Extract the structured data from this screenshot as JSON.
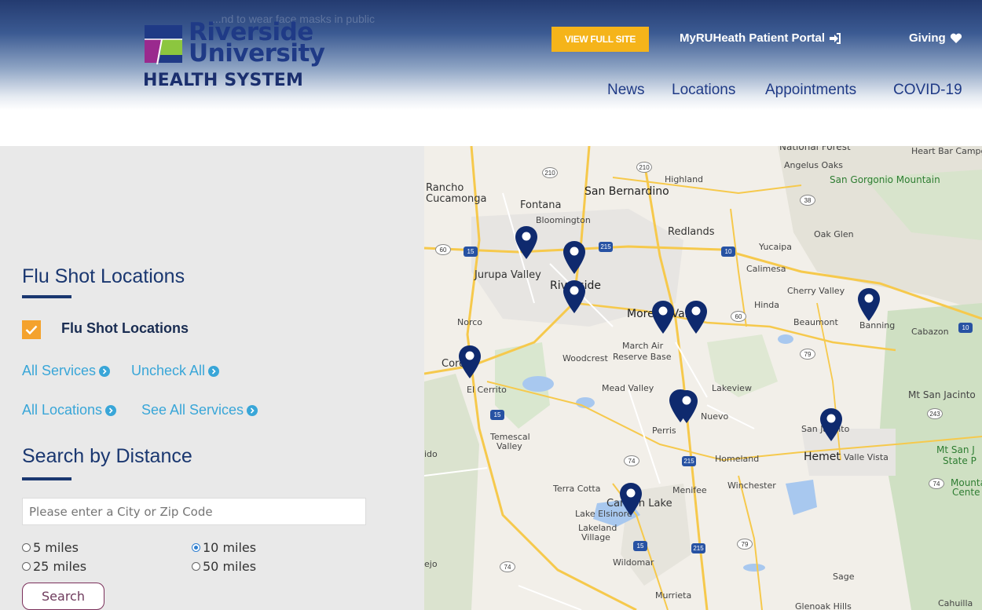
{
  "header": {
    "alert_ghost": "...nd to wear face masks in public",
    "logo": {
      "line1": "Riverside",
      "line2": "University",
      "line3": "HEALTH SYSTEM"
    },
    "view_full_site": "VIEW FULL SITE",
    "portal_link": "MyRUHeath Patient Portal",
    "giving_link": "Giving",
    "nav": [
      "News",
      "Locations",
      "Appointments",
      "COVID-19"
    ]
  },
  "filters": {
    "title": "Flu Shot Locations",
    "checkbox_label": "Flu Shot Locations",
    "checkbox_checked": true,
    "links": {
      "all_services": "All Services",
      "uncheck_all": "Uncheck All",
      "all_locations": "All Locations",
      "see_all_services": "See All Services"
    }
  },
  "distance": {
    "title": "Search by Distance",
    "placeholder": "Please enter a City or Zip Code",
    "options": [
      "5 miles",
      "10 miles",
      "25 miles",
      "50 miles"
    ],
    "selected": "10 miles",
    "search_button": "Search"
  },
  "map": {
    "labels": [
      "National Forest",
      "Heart Bar Campground",
      "Angelus Oaks",
      "San Gorgonio Mountain",
      "Highland",
      "Rancho",
      "Cucamonga",
      "San Bernardino",
      "Fontana",
      "Bloomington",
      "Redlands",
      "Oak Glen",
      "Yucaipa",
      "Calimesa",
      "Jurupa Valley",
      "Riverside",
      "Cherry Valley",
      "Hinda",
      "Beaumont",
      "Banning",
      "Cabazon",
      "Norco",
      "Moreno Valley",
      "March Air",
      "Reserve Base",
      "Woodcrest",
      "Corona",
      "El Cerrito",
      "Mead Valley",
      "Lakeview",
      "Mt San Jacinto",
      "Nuevo",
      "Perris",
      "San Jacinto",
      "Temescal",
      "Valley",
      "Homeland",
      "Hemet",
      "Valle Vista",
      "Mt San J",
      "State P",
      "Mounta",
      "Cente",
      "Winchester",
      "Terra Cotta",
      "Canyon Lake",
      "Menifee",
      "Lake Elsinore",
      "Lakeland",
      "Village",
      "Wildomar",
      "Sage",
      "Murrieta",
      "Glenoak Hills",
      "Cahuilla",
      "ido",
      "ejo"
    ],
    "highway_shields": [
      "210",
      "210",
      "38",
      "60",
      "15",
      "215",
      "10",
      "60",
      "10",
      "79",
      "15",
      "243",
      "74",
      "215",
      "74",
      "15",
      "215",
      "79",
      "74"
    ]
  },
  "colors": {
    "navy": "#1a3770",
    "accent_orange": "#f4a22d",
    "view_full_yellow": "#f5b41a",
    "link_blue": "#39a6d8",
    "pin_navy": "#0f2a6e",
    "panel_gray": "#e9e9e9",
    "search_border": "#7b2f5a"
  }
}
